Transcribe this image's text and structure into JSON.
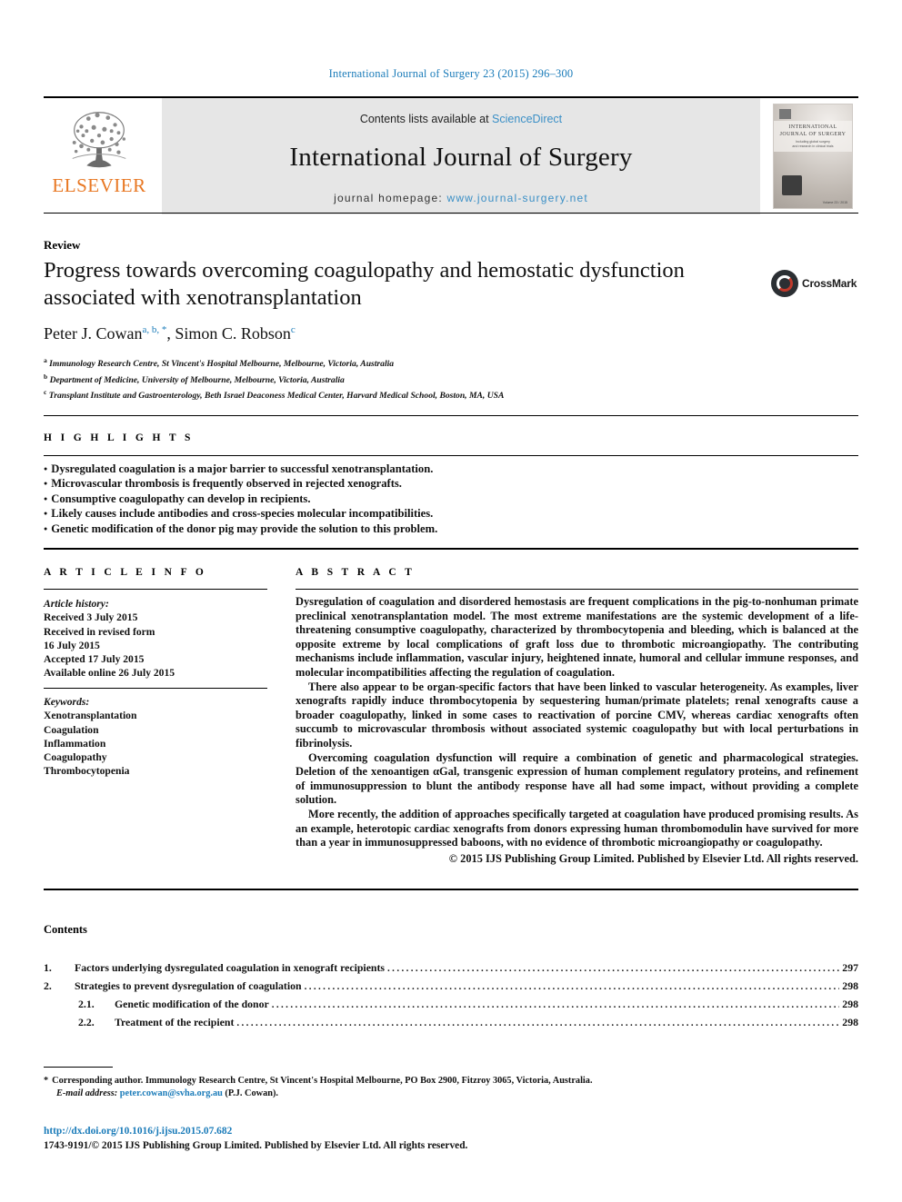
{
  "running_head": "International Journal of Surgery 23 (2015) 296–300",
  "masthead": {
    "publisher_name": "ELSEVIER",
    "contents_prefix": "Contents lists available at ",
    "contents_link": "ScienceDirect",
    "journal_title": "International Journal of Surgery",
    "homepage_prefix": "journal homepage: ",
    "homepage_url": "www.journal-surgery.net",
    "cover": {
      "title_line1": "INTERNATIONAL",
      "title_line2": "JOURNAL OF SURGERY",
      "subtitle_line1": "Including global surgery",
      "subtitle_line2": "and research in clinical trials",
      "volume_note": "Volume 23 / 2015"
    }
  },
  "article_type": "Review",
  "title": "Progress towards overcoming coagulopathy and hemostatic dysfunction associated with xenotransplantation",
  "crossmark_label": "CrossMark",
  "authors": [
    {
      "name": "Peter J. Cowan",
      "marks": "a, b, *"
    },
    {
      "name": "Simon C. Robson",
      "marks": "c"
    }
  ],
  "affiliations": [
    {
      "mark": "a",
      "text": "Immunology Research Centre, St Vincent's Hospital Melbourne, Melbourne, Victoria, Australia"
    },
    {
      "mark": "b",
      "text": "Department of Medicine, University of Melbourne, Melbourne, Victoria, Australia"
    },
    {
      "mark": "c",
      "text": "Transplant Institute and Gastroenterology, Beth Israel Deaconess Medical Center, Harvard Medical School, Boston, MA, USA"
    }
  ],
  "highlights": {
    "heading": "H I G H L I G H T S",
    "items": [
      "Dysregulated coagulation is a major barrier to successful xenotransplantation.",
      "Microvascular thrombosis is frequently observed in rejected xenografts.",
      "Consumptive coagulopathy can develop in recipients.",
      "Likely causes include antibodies and cross-species molecular incompatibilities.",
      "Genetic modification of the donor pig may provide the solution to this problem."
    ]
  },
  "article_info": {
    "heading": "A R T I C L E  I N F O",
    "history_label": "Article history:",
    "history": [
      "Received 3 July 2015",
      "Received in revised form",
      "16 July 2015",
      "Accepted 17 July 2015",
      "Available online 26 July 2015"
    ],
    "keywords_label": "Keywords:",
    "keywords": [
      "Xenotransplantation",
      "Coagulation",
      "Inflammation",
      "Coagulopathy",
      "Thrombocytopenia"
    ]
  },
  "abstract": {
    "heading": "A B S T R A C T",
    "paragraphs": [
      "Dysregulation of coagulation and disordered hemostasis are frequent complications in the pig-to-nonhuman primate preclinical xenotransplantation model. The most extreme manifestations are the systemic development of a life-threatening consumptive coagulopathy, characterized by thrombocytopenia and bleeding, which is balanced at the opposite extreme by local complications of graft loss due to thrombotic microangiopathy. The contributing mechanisms include inflammation, vascular injury, heightened innate, humoral and cellular immune responses, and molecular incompatibilities affecting the regulation of coagulation.",
      "There also appear to be organ-specific factors that have been linked to vascular heterogeneity. As examples, liver xenografts rapidly induce thrombocytopenia by sequestering human/primate platelets; renal xenografts cause a broader coagulopathy, linked in some cases to reactivation of porcine CMV, whereas cardiac xenografts often succumb to microvascular thrombosis without associated systemic coagulopathy but with local perturbations in fibrinolysis.",
      "Overcoming coagulation dysfunction will require a combination of genetic and pharmacological strategies. Deletion of the xenoantigen αGal, transgenic expression of human complement regulatory proteins, and refinement of immunosuppression to blunt the antibody response have all had some impact, without providing a complete solution.",
      "More recently, the addition of approaches specifically targeted at coagulation have produced promising results. As an example, heterotopic cardiac xenografts from donors expressing human thrombomodulin have survived for more than a year in immunosuppressed baboons, with no evidence of thrombotic microangiopathy or coagulopathy."
    ],
    "copyright": "© 2015 IJS Publishing Group Limited. Published by Elsevier Ltd. All rights reserved."
  },
  "contents": {
    "heading": "Contents",
    "dots": "..........................................................................................................................................................................................",
    "entries": [
      {
        "num": "1.",
        "label": "Factors underlying dysregulated coagulation in xenograft recipients",
        "page": "297",
        "level": 1
      },
      {
        "num": "2.",
        "label": "Strategies to prevent dysregulation of coagulation",
        "page": "298",
        "level": 1
      },
      {
        "num": "2.1.",
        "label": "Genetic modification of the donor",
        "page": "298",
        "level": 2
      },
      {
        "num": "2.2.",
        "label": "Treatment of the recipient",
        "page": "298",
        "level": 2
      }
    ]
  },
  "footnote": {
    "star": "*",
    "corresponding": "Corresponding author. Immunology Research Centre, St Vincent's Hospital Melbourne, PO Box 2900, Fitzroy 3065, Victoria, Australia.",
    "email_label": "E-mail address:",
    "email": "peter.cowan@svha.org.au",
    "email_suffix": "(P.J. Cowan)."
  },
  "footer": {
    "doi": "http://dx.doi.org/10.1016/j.ijsu.2015.07.682",
    "issn_line": "1743-9191/© 2015 IJS Publishing Group Limited. Published by Elsevier Ltd. All rights reserved."
  }
}
